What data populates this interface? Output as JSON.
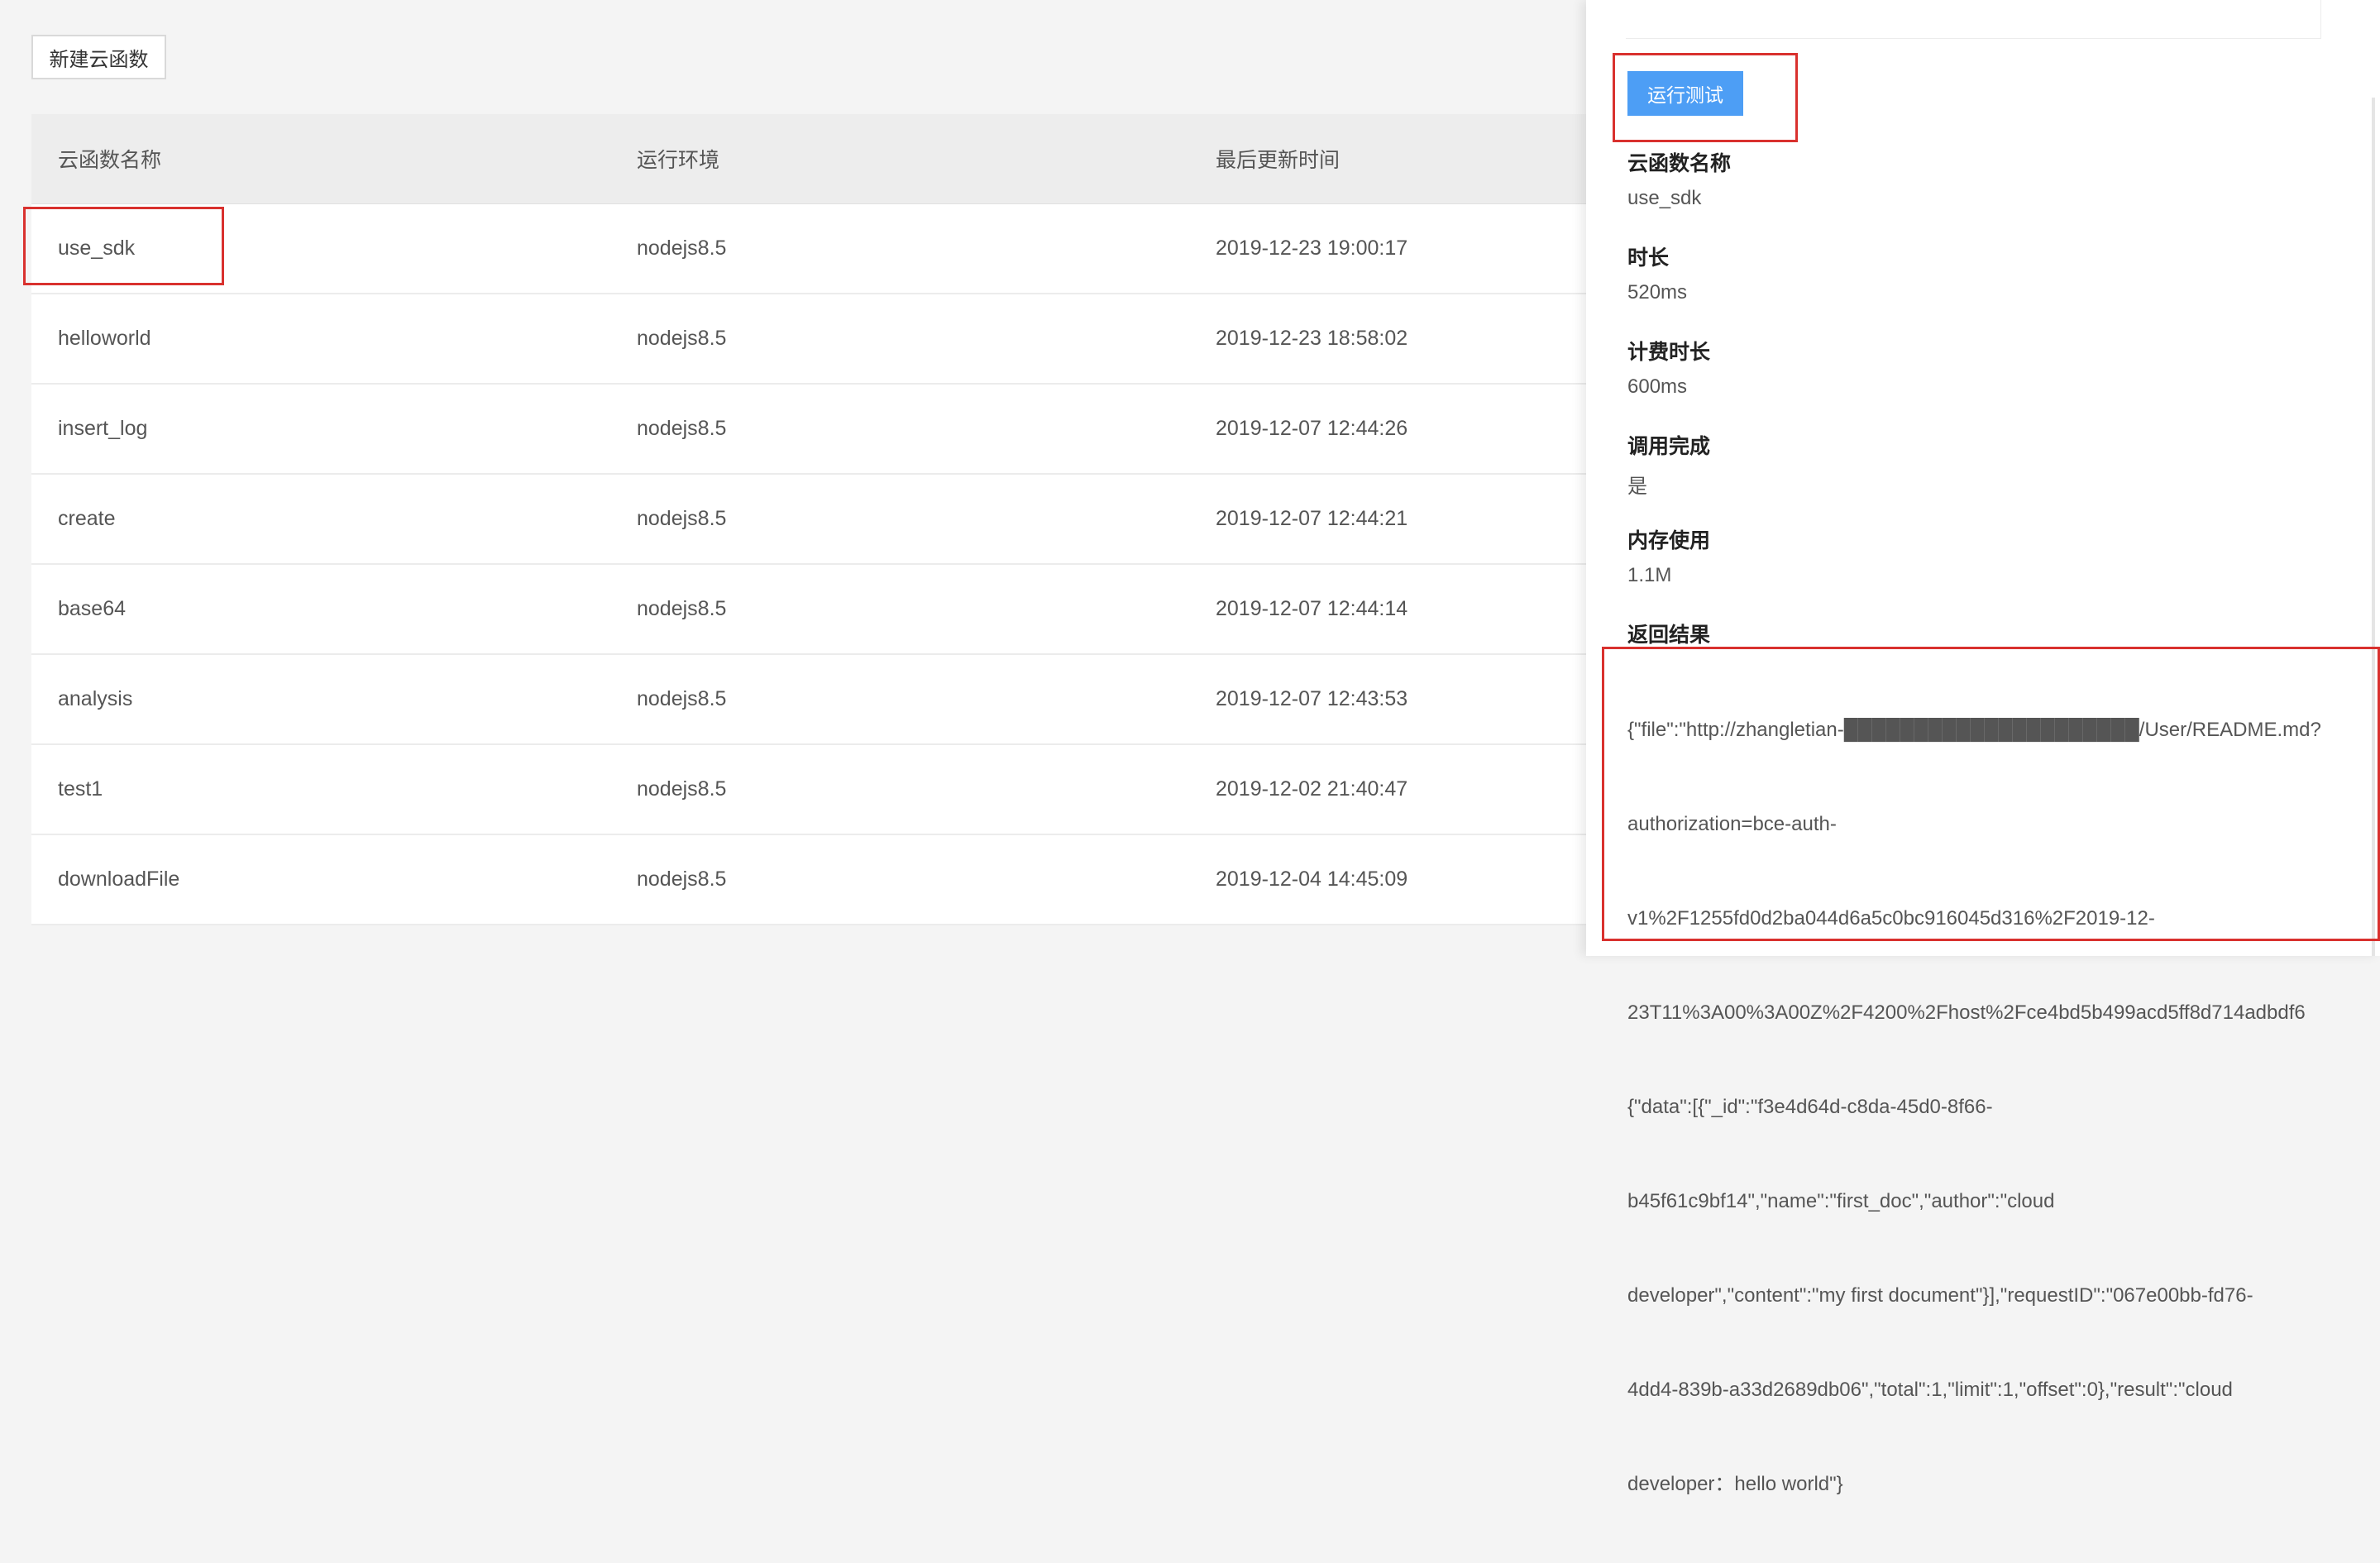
{
  "toolbar": {
    "new_button": "新建云函数"
  },
  "table": {
    "headers": [
      "云函数名称",
      "运行环境",
      "最后更新时间"
    ],
    "rows": [
      [
        "use_sdk",
        "nodejs8.5",
        "2019-12-23 19:00:17"
      ],
      [
        "helloworld",
        "nodejs8.5",
        "2019-12-23 18:58:02"
      ],
      [
        "insert_log",
        "nodejs8.5",
        "2019-12-07 12:44:26"
      ],
      [
        "create",
        "nodejs8.5",
        "2019-12-07 12:44:21"
      ],
      [
        "base64",
        "nodejs8.5",
        "2019-12-07 12:44:14"
      ],
      [
        "analysis",
        "nodejs8.5",
        "2019-12-07 12:43:53"
      ],
      [
        "test1",
        "nodejs8.5",
        "2019-12-02 21:40:47"
      ],
      [
        "downloadFile",
        "nodejs8.5",
        "2019-12-04 14:45:09"
      ]
    ]
  },
  "panel": {
    "run_button": "运行测试",
    "fields": [
      {
        "label": "云函数名称",
        "value": "use_sdk"
      },
      {
        "label": "时长",
        "value": "520ms"
      },
      {
        "label": "计费时长",
        "value": "600ms"
      },
      {
        "label": "调用完成",
        "value": "是"
      },
      {
        "label": "内存使用",
        "value": "1.1M"
      }
    ],
    "result_label": "返回结果",
    "result_lines": [
      "{\"file\":\"http://zhangletian-█████████████████████/User/README.md?",
      "authorization=bce-auth-",
      "v1%2F1255fd0d2ba044d6a5c0bc916045d316%2F2019-12-",
      "23T11%3A00%3A00Z%2F4200%2Fhost%2Fce4bd5b499acd5ff8d714adbdf6",
      "{\"data\":[{\"_id\":\"f3e4d64d-c8da-45d0-8f66-",
      "b45f61c9bf14\",\"name\":\"first_doc\",\"author\":\"cloud",
      "developer\",\"content\":\"my first document\"}],\"requestID\":\"067e00bb-fd76-",
      "4dd4-839b-a33d2689db06\",\"total\":1,\"limit\":1,\"offset\":0},\"result\":\"cloud",
      "developer：hello world\"}"
    ]
  }
}
